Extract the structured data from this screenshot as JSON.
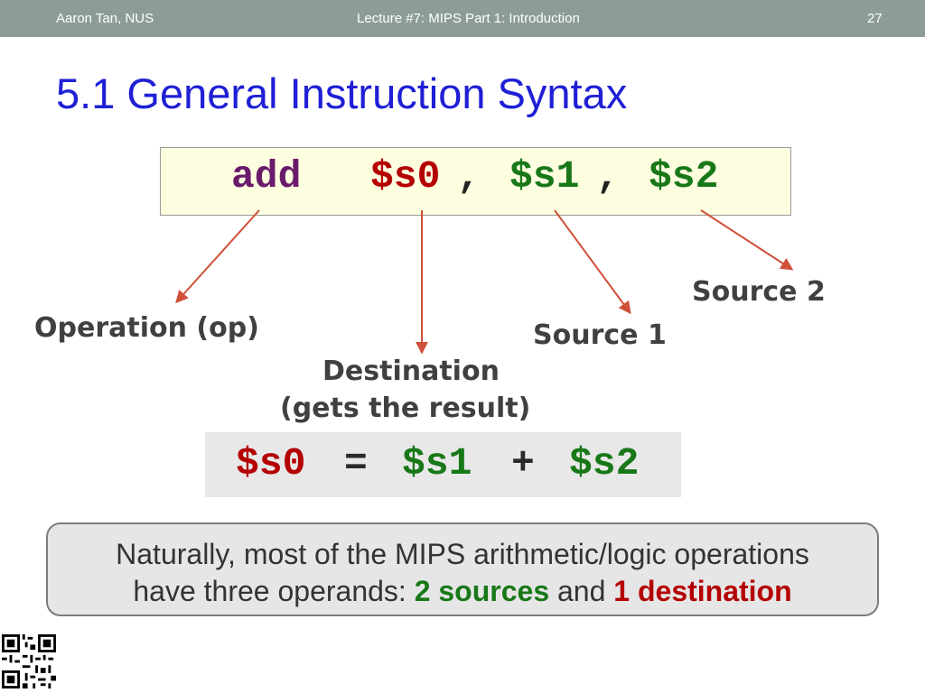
{
  "header": {
    "author": "Aaron Tan, NUS",
    "lecture": "Lecture #7: MIPS Part 1: Introduction",
    "page_number": "27"
  },
  "title": "5.1 General Instruction Syntax",
  "instruction": {
    "op": "add",
    "dest": "$s0",
    "src1": "$s1",
    "src2": "$s2",
    "sep": ","
  },
  "labels": {
    "operation": "Operation (op)",
    "destination_line1": "Destination",
    "destination_line2": "(gets the result)",
    "source1": "Source 1",
    "source2": "Source 2"
  },
  "equation": {
    "lhs": "$s0",
    "equals": "=",
    "src1": "$s1",
    "plus": "+",
    "src2": "$s2"
  },
  "note": {
    "line1": "Naturally, most of the MIPS arithmetic/logic operations",
    "line2_prefix": "have three operands: ",
    "sources": "2 sources",
    "and": " and ",
    "destination": "1 destination"
  },
  "colors": {
    "title": "#1f1fd6",
    "op": "#6a1a6a",
    "dest": "#b40000",
    "src": "#187818",
    "arrow": "#d0503a",
    "topbar": "#8d9d95"
  }
}
